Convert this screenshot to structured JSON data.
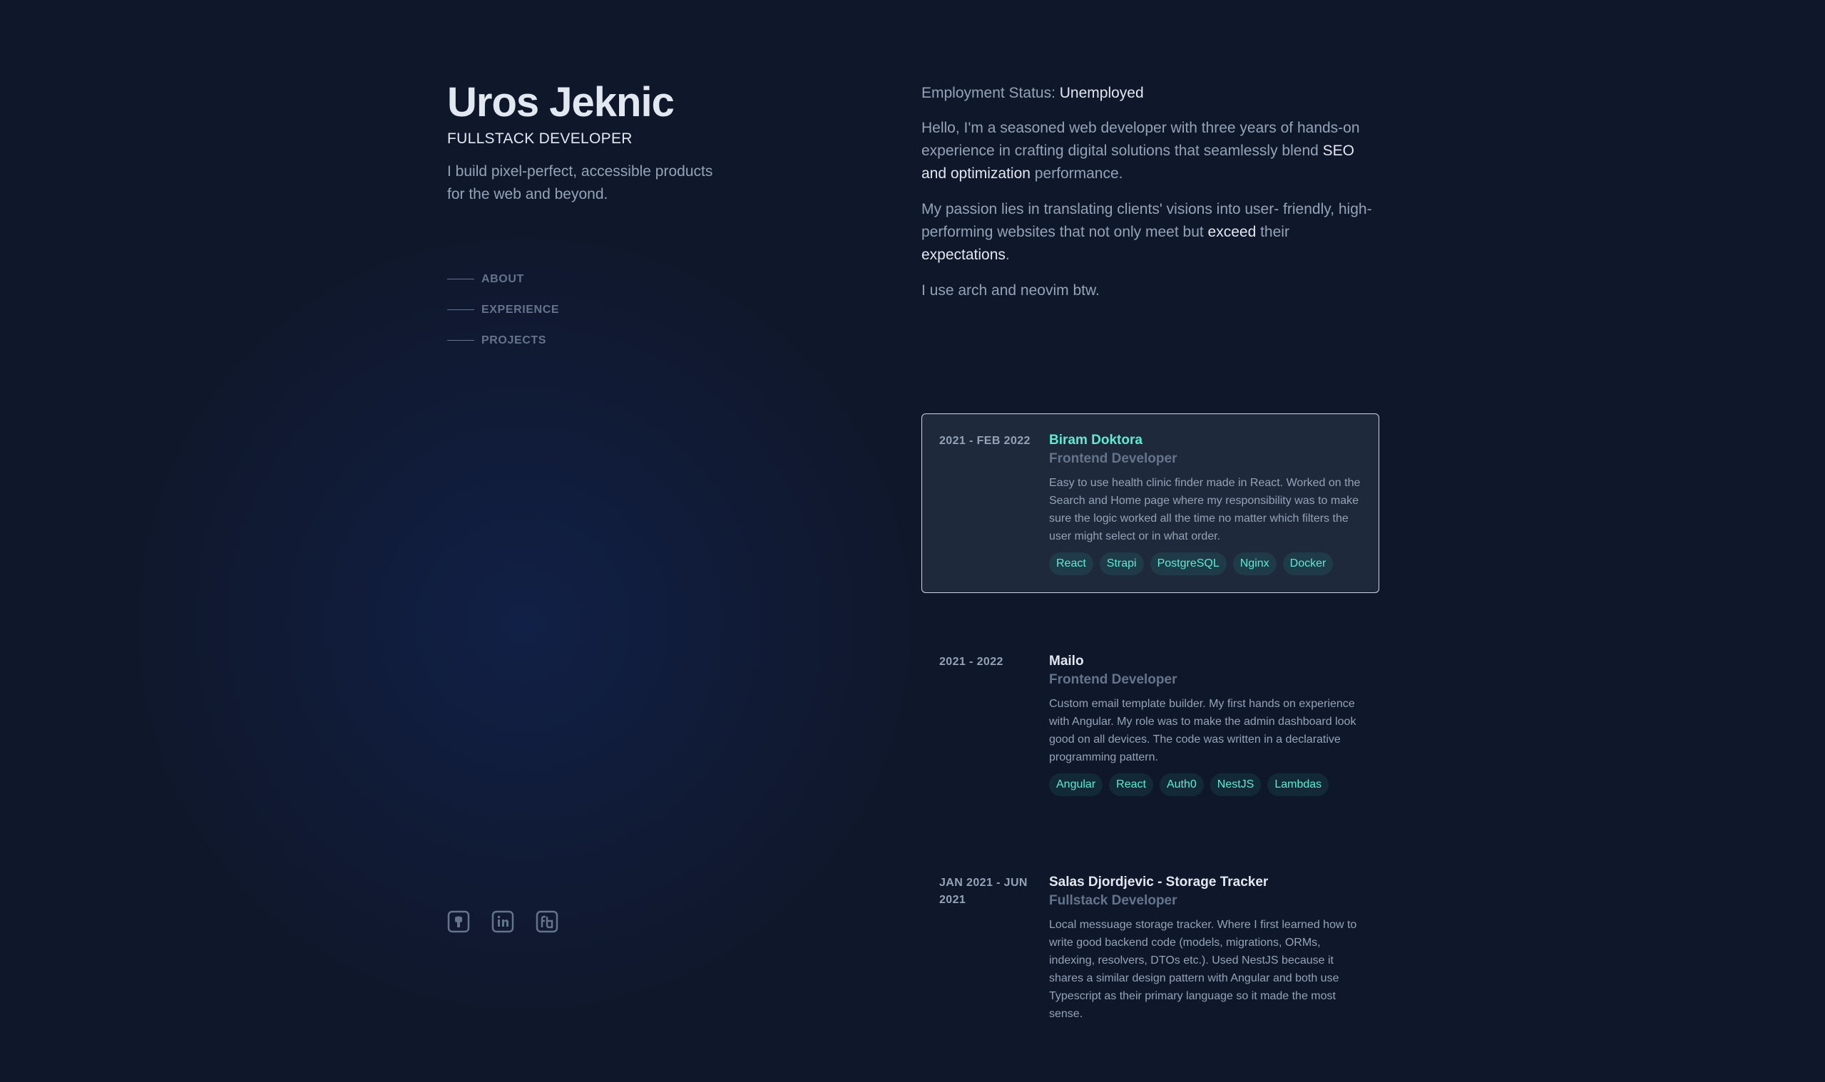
{
  "profile": {
    "name": "Uros Jeknic",
    "role": "FULLSTACK DEVELOPER",
    "tagline": "I build pixel-perfect, accessible products for the web and beyond."
  },
  "nav": [
    {
      "label": "ABOUT"
    },
    {
      "label": "EXPERIENCE"
    },
    {
      "label": "PROJECTS"
    }
  ],
  "social": [
    {
      "icon": "github-icon"
    },
    {
      "icon": "linkedin-icon"
    },
    {
      "icon": "freecodecamp-icon"
    }
  ],
  "about": {
    "status_label": "Employment Status: ",
    "status_value": "Unemployed",
    "p1_a": "Hello, I'm a seasoned web developer with three years of hands-on experience in crafting digital solutions that seamlessly blend ",
    "p1_hl": "SEO and optimization",
    "p1_b": " performance.",
    "p2_a": "My passion lies in translating clients' visions into user- friendly, high-performing websites that not only meet but ",
    "p2_hl": "exceed",
    "p2_b": " their ",
    "p2_hl2": "expectations",
    "p2_c": ".",
    "p3": "I use arch and neovim btw."
  },
  "experience": [
    {
      "date": "2021 - FEB 2022",
      "company": "Biram Doktora",
      "title": "Frontend Developer",
      "description": "Easy to use health clinic finder made in React. Worked on the Search and Home page where my responsibility was to make sure the logic worked all the time no matter which filters the user might select or in what order.",
      "tags": [
        "React",
        "Strapi",
        "PostgreSQL",
        "Nginx",
        "Docker"
      ]
    },
    {
      "date": "2021 - 2022",
      "company": "Mailo",
      "title": "Frontend Developer",
      "description": "Custom email template builder. My first hands on experience with Angular. My role was to make the admin dashboard look good on all devices. The code was written in a declarative programming pattern.",
      "tags": [
        "Angular",
        "React",
        "Auth0",
        "NestJS",
        "Lambdas"
      ]
    },
    {
      "date": "JAN 2021 - JUN 2021",
      "company": "Salas Djordjevic - Storage Tracker",
      "title": "Fullstack Developer",
      "description": "Local messuage storage tracker. Where I first learned how to write good backend code (models, migrations, ORMs, indexing, resolvers, DTOs etc.). Used NestJS because it shares a similar design pattern with Angular and both use Typescript as their primary language so it made the most sense.",
      "tags": []
    }
  ],
  "colors": {
    "background": "#0f172a",
    "accent": "#5eead4",
    "heading": "#e2e8f0",
    "muted": "#94a3b8"
  }
}
